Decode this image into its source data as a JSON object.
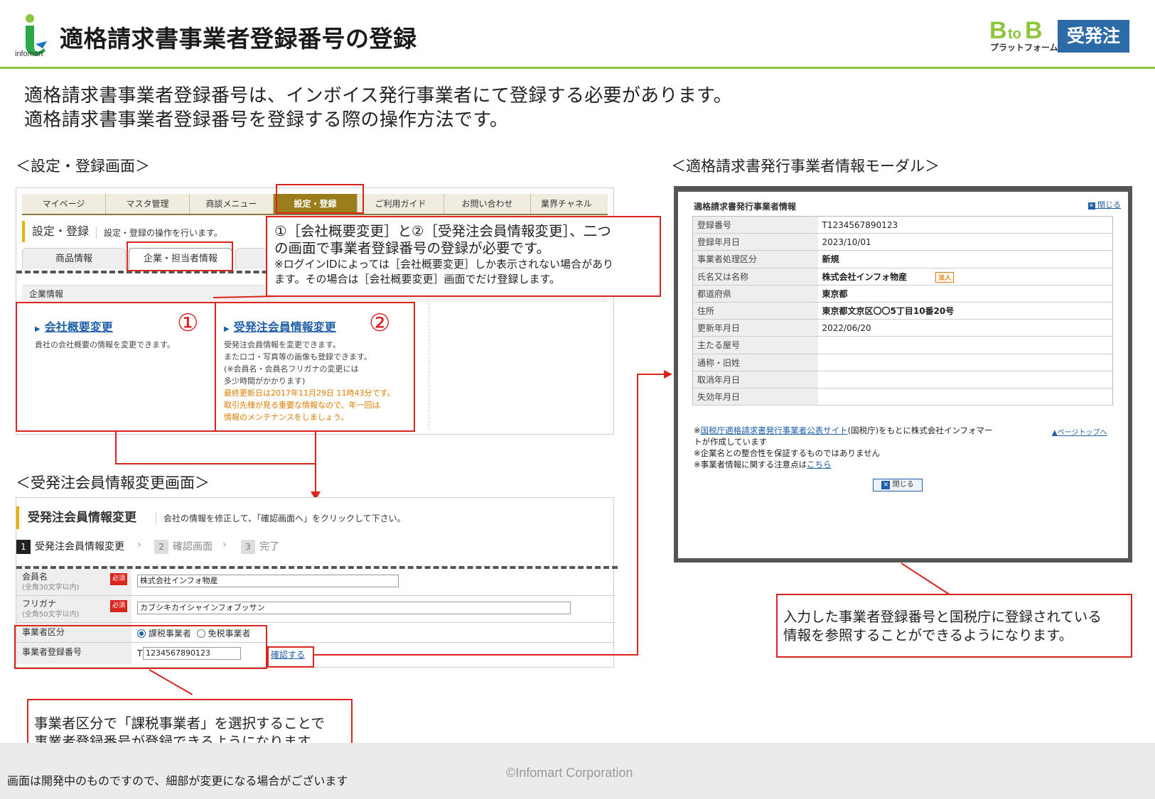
{
  "header": {
    "logo_text": "infomart",
    "title": "適格請求書事業者登録番号の登録",
    "brand_top": "BtoB",
    "brand_bottom": "プラットフォーム",
    "badge": "受発注"
  },
  "intro": {
    "line1": "適格請求書事業者登録番号は、インボイス発行事業者にて登録する必要があります。",
    "line2": "適格請求書事業者登録番号を登録する際の操作方法です。"
  },
  "settings_screen": {
    "label": "＜設定・登録画面＞",
    "nav": [
      "マイページ",
      "マスタ管理",
      "商談メニュー",
      "設定・登録",
      "ご利用ガイド",
      "お問い合わせ",
      "業界チャネル"
    ],
    "heading": "設定・登録",
    "description": "設定・登録の操作を行います。",
    "subtabs": [
      "商品情報",
      "企業・担当者情報"
    ],
    "company_bar": "企業情報",
    "link1": {
      "num": "①",
      "title": "会社概要変更",
      "desc": "貴社の会社概要の情報を変更できます。"
    },
    "link2": {
      "num": "②",
      "title": "受発注会員情報変更",
      "desc": [
        "受発注会員情報を変更できます。",
        "またロゴ・写真等の画像も登録できます。",
        "(※会員名・会員名フリガナの変更には",
        "多少時間がかかります)"
      ],
      "notice": [
        "最終更新日は2017年11月29日 11時43分です。",
        "取引先様が見る重要な情報なので、年一回は",
        "情報のメンテナンスをしましょう。"
      ]
    }
  },
  "callout_top": {
    "line1": "①［会社概要変更］と②［受発注会員情報変更］、二つ",
    "line2": "の画面で事業者登録番号の登録が必要です。",
    "note1": "※ログインIDによっては［会社概要変更］しか表示されない場合があり",
    "note2": "ます。その場合は［会社概要変更］画面でだけ登録します。"
  },
  "member_screen": {
    "label": "＜受発注会員情報変更画面＞",
    "heading": "受発注会員情報変更",
    "description": "会社の情報を修正して、「確認画面へ」をクリックして下さい。",
    "steps": [
      {
        "num": "1",
        "label": "受発注会員情報変更"
      },
      {
        "num": "2",
        "label": "確認画面"
      },
      {
        "num": "3",
        "label": "完了"
      }
    ],
    "required_badge": "必須",
    "fields": {
      "member_name_label": "会員名",
      "member_name_sub": "(全角30文字以内)",
      "member_name_value": "株式会社インフォ物産",
      "furigana_label": "フリガナ",
      "furigana_sub": "(全角50文字以内)",
      "furigana_value": "カブシキカイシャインフォブッサン",
      "category_label": "事業者区分",
      "category_taxable": "課税事業者",
      "category_exempt": "免税事業者",
      "category_selected": "課税事業者",
      "regnum_label": "事業者登録番号",
      "regnum_prefix": "T",
      "regnum_value": "1234567890123",
      "confirm_link": "確認する"
    }
  },
  "callout_bottom_left": {
    "line1": "事業者区分で「課税事業者」を選択することで",
    "line2": "事業者登録番号が登録できるようになります。"
  },
  "modal_section": {
    "label": "＜適格請求書発行事業者情報モーダル＞",
    "title": "適格請求書発行事業者情報",
    "close_top": "閉じる",
    "rows": [
      {
        "label": "登録番号",
        "value": "T1234567890123"
      },
      {
        "label": "登録年月日",
        "value": "2023/10/01"
      },
      {
        "label": "事業者処理区分",
        "value": "新規"
      },
      {
        "label": "氏名又は名称",
        "value": "株式会社インフォ物産"
      },
      {
        "label": "都道府県",
        "value": "東京都"
      },
      {
        "label": "住所",
        "value": "東京都文京区〇〇5丁目10番20号"
      },
      {
        "label": "更新年月日",
        "value": "2022/06/20"
      },
      {
        "label": "主たる屋号",
        "value": ""
      },
      {
        "label": "通称・旧姓",
        "value": ""
      },
      {
        "label": "取消年月日",
        "value": ""
      },
      {
        "label": "失効年月日",
        "value": ""
      }
    ],
    "corp_tag": "法人",
    "note1_prefix": "※",
    "note1_link": "国税庁適格請求書発行事業者公表サイト",
    "note1_rest": "(国税庁)をもとに株式会社インフォマー",
    "note1_cont": "トが作成しています",
    "note2": "※企業名との整合性を保証するものではありません",
    "note3_prefix": "※事業者情報に関する注意点は",
    "note3_link": "こちら",
    "page_top": "▲ページトップへ",
    "close_button": "閉じる"
  },
  "callout_right": {
    "line1": "入力した事業者登録番号と国税庁に登録されている",
    "line2": "情報を参照することができるようになります。"
  },
  "footer": {
    "note": "画面は開発中のものですので、細部が変更になる場合がございます",
    "copyright": "©Infomart Corporation"
  },
  "colors": {
    "accent_green": "#8cc63f",
    "badge_blue": "#2d6aa8",
    "callout_red": "#d9251d",
    "nav_gold": "#9b7d1c"
  }
}
